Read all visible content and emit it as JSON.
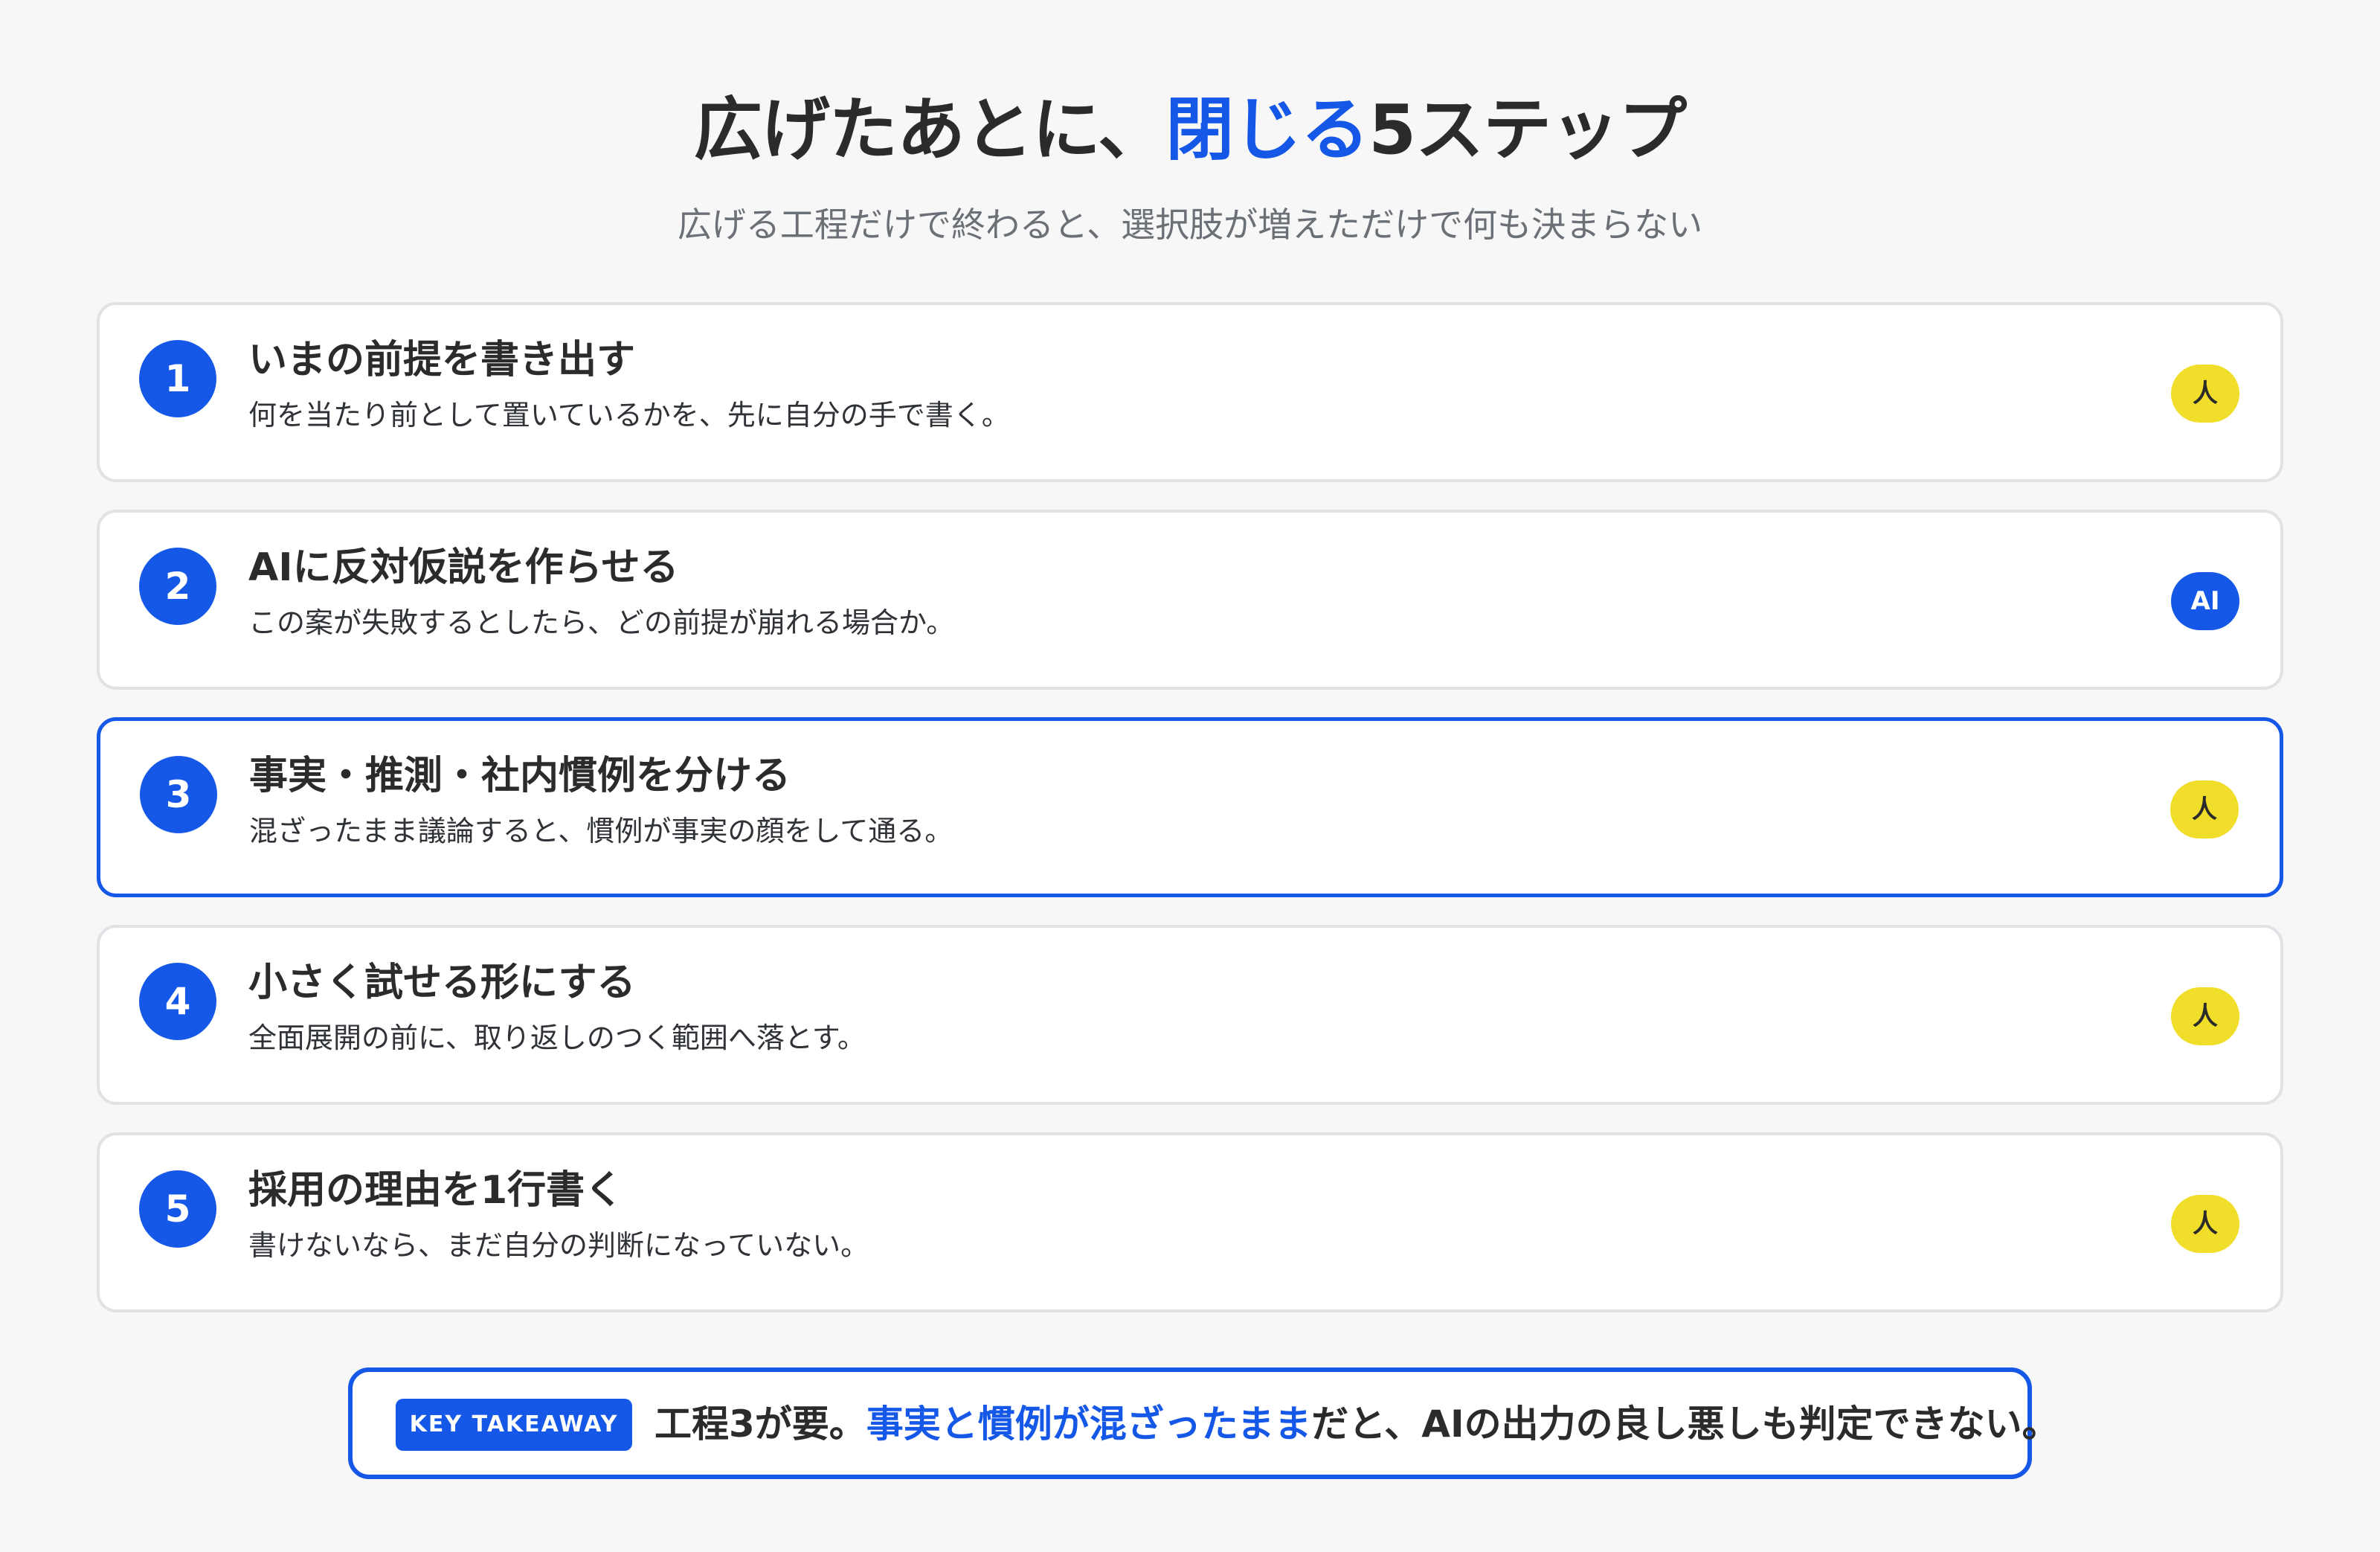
{
  "header": {
    "title_prefix": "広げたあとに、",
    "title_highlight": "閉じる",
    "title_suffix": "5ステップ",
    "subtitle": "広げる工程だけで終わると、選択肢が増えただけで何も決まらない"
  },
  "steps": [
    {
      "number": "1",
      "title": "いまの前提を書き出す",
      "description": "何を当たり前として置いているかを、先に自分の手で書く。",
      "badge": "人",
      "badge_type": "human"
    },
    {
      "number": "2",
      "title": "AIに反対仮説を作らせる",
      "description": "この案が失敗するとしたら、どの前提が崩れる場合か。",
      "badge": "AI",
      "badge_type": "ai"
    },
    {
      "number": "3",
      "title": "事実・推測・社内慣例を分ける",
      "description": "混ざったまま議論すると、慣例が事実の顔をして通る。",
      "badge": "人",
      "badge_type": "human"
    },
    {
      "number": "4",
      "title": "小さく試せる形にする",
      "description": "全面展開の前に、取り返しのつく範囲へ落とす。",
      "badge": "人",
      "badge_type": "human"
    },
    {
      "number": "5",
      "title": "採用の理由を1行書く",
      "description": "書けないなら、まだ自分の判断になっていない。",
      "badge": "人",
      "badge_type": "human"
    }
  ],
  "takeaway": {
    "label": "KEY TAKEAWAY",
    "text_prefix": "工程3が要。",
    "text_highlight": "事実と慣例が混ざったまま",
    "text_suffix": "だと、AIの出力の良し悪しも判定できない。"
  },
  "colors": {
    "accent": "#1558e8",
    "human_badge": "#f1de2a",
    "background": "#f7f7f7"
  }
}
